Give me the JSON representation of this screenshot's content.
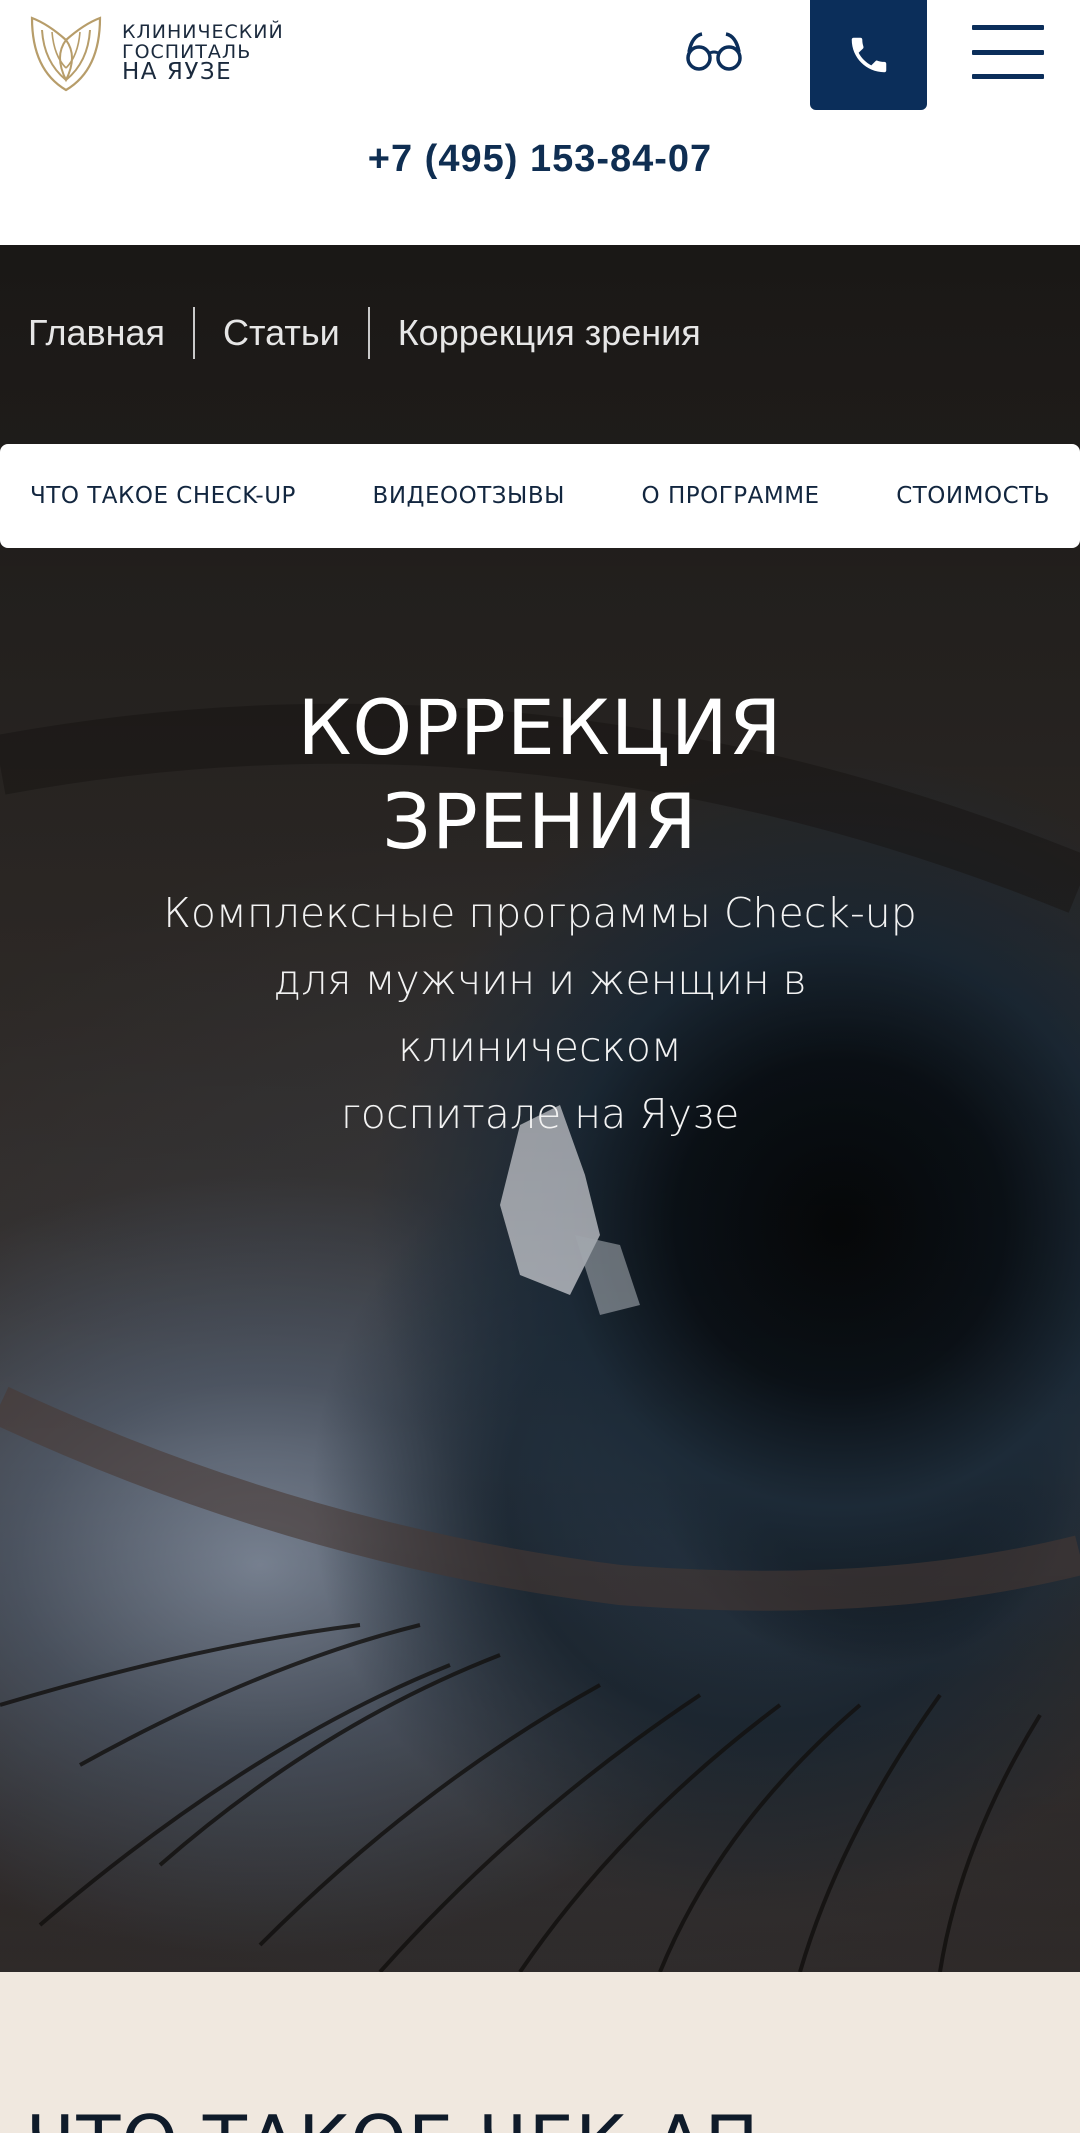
{
  "header": {
    "logo": {
      "line1": "КЛИНИЧЕСКИЙ",
      "line2": "ГОСПИТАЛЬ",
      "line3": "НА ЯУЗЕ",
      "icon": "lotus-logo-icon",
      "color": "#b79d6a"
    },
    "accessibility_icon": "glasses-icon",
    "call_icon": "phone-icon",
    "menu_icon": "hamburger-menu-icon",
    "phone": "+7 (495) 153-84-07",
    "accent_color": "#0b2e5a"
  },
  "breadcrumbs": [
    "Главная",
    "Статьи",
    "Коррекция зрения"
  ],
  "subnav": [
    "ЧТО ТАКОЕ CHECK-UP",
    "ВИДЕООТЗЫВЫ",
    "О ПРОГРАММЕ",
    "СТОИМОСТЬ"
  ],
  "hero": {
    "title_line1": "КОРРЕКЦИЯ",
    "title_line2": "ЗРЕНИЯ",
    "subtitle_line1": "Комплексные программы Check-up",
    "subtitle_line2": "для мужчин и женщин в клиническом",
    "subtitle_line3": "госпитале на Яузе"
  },
  "next_section": {
    "title": "ЧТО ТАКОЕ ЧЕК-АП",
    "background": "#f0e8df"
  }
}
